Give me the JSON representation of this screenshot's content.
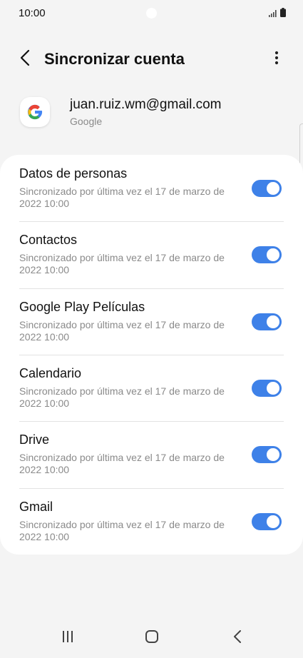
{
  "status_bar": {
    "time": "10:00"
  },
  "app_bar": {
    "title": "Sincronizar cuenta"
  },
  "account": {
    "email": "juan.ruiz.wm@gmail.com",
    "provider": "Google",
    "logo_icon": "google-logo"
  },
  "sync_items": [
    {
      "title": "Datos de personas",
      "subtitle": "Sincronizado por última vez el 17 de marzo de 2022 10:00",
      "enabled": true
    },
    {
      "title": "Contactos",
      "subtitle": "Sincronizado por última vez el 17 de marzo de 2022 10:00",
      "enabled": true
    },
    {
      "title": "Google Play Películas",
      "subtitle": "Sincronizado por última vez el 17 de marzo de 2022 10:00",
      "enabled": true
    },
    {
      "title": "Calendario",
      "subtitle": "Sincronizado por última vez el 17 de marzo de 2022 10:00",
      "enabled": true
    },
    {
      "title": "Drive",
      "subtitle": "Sincronizado por última vez el 17 de marzo de 2022 10:00",
      "enabled": true
    },
    {
      "title": "Gmail",
      "subtitle": "Sincronizado por última vez el 17 de marzo de 2022 10:00",
      "enabled": true
    }
  ],
  "colors": {
    "accent": "#3e81e8",
    "background": "#f4f4f4",
    "card": "#ffffff",
    "secondary_text": "#8a8a8a"
  },
  "icons": {
    "back": "back-arrow-icon",
    "more": "more-vertical-icon",
    "nav_recents": "recents-icon",
    "nav_home": "home-icon",
    "nav_back": "nav-back-icon"
  }
}
